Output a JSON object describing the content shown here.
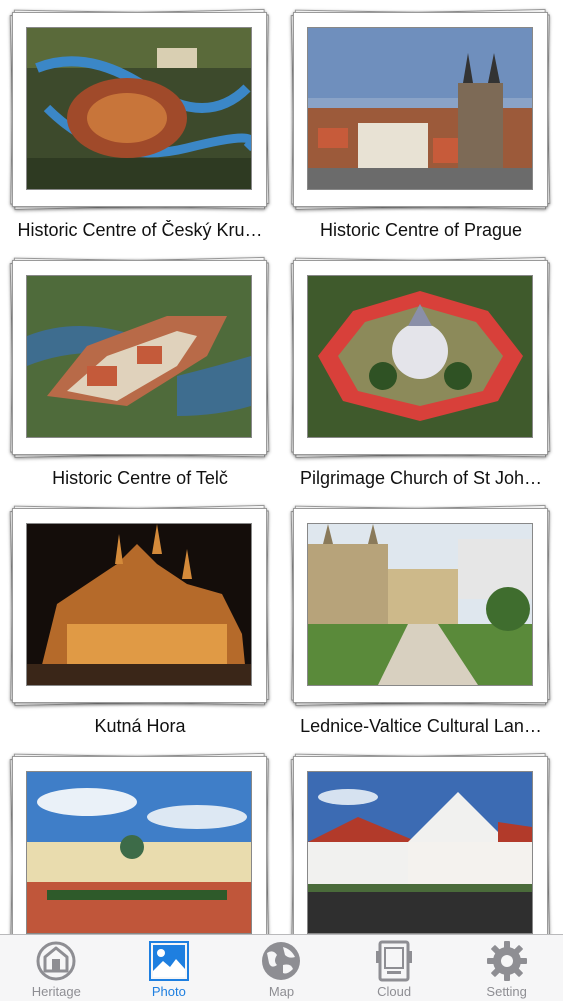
{
  "sites": [
    {
      "title": "Historic Centre of Český Kru…"
    },
    {
      "title": "Historic Centre of Prague"
    },
    {
      "title": "Historic Centre of Telč"
    },
    {
      "title": "Pilgrimage Church of St Joh…"
    },
    {
      "title": "Kutná Hora"
    },
    {
      "title": "Lednice-Valtice Cultural Lan…"
    },
    {
      "title": ""
    },
    {
      "title": ""
    }
  ],
  "tabbar": {
    "active_tab": "Photo",
    "accent_color": "#1e7fe0",
    "tabs": [
      {
        "label": "Heritage",
        "icon": "heritage-icon"
      },
      {
        "label": "Photo",
        "icon": "photo-icon"
      },
      {
        "label": "Map",
        "icon": "globe-icon"
      },
      {
        "label": "Cloud",
        "icon": "cloud-icon"
      },
      {
        "label": "Setting",
        "icon": "gear-icon"
      }
    ]
  }
}
